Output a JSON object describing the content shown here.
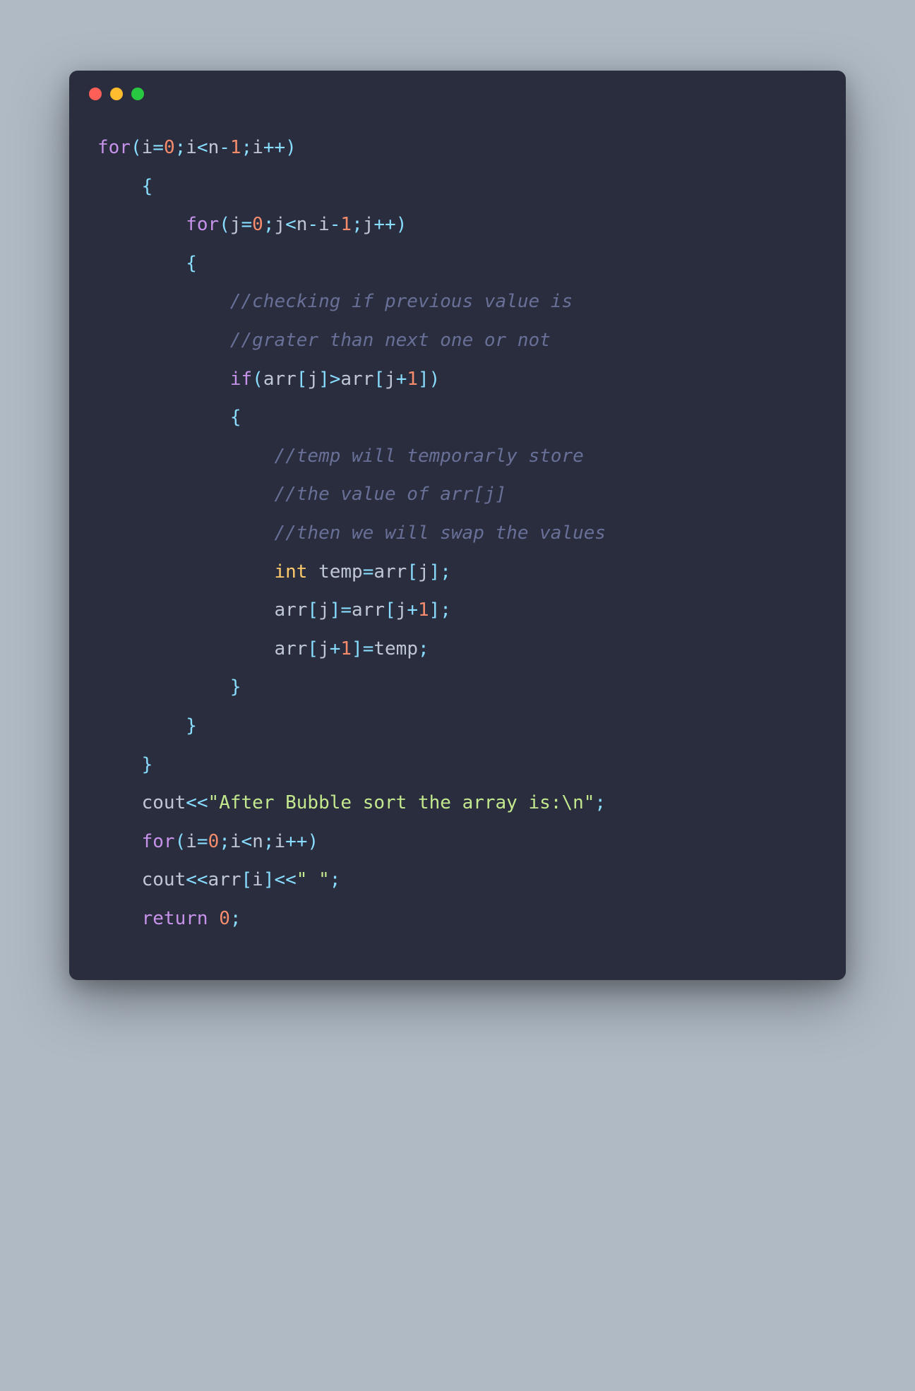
{
  "window": {
    "traffic_lights": [
      "close",
      "minimize",
      "zoom"
    ]
  },
  "colors": {
    "background_page": "#b0bac5",
    "background_window": "#292d3e",
    "keyword": "#c792ea",
    "operator": "#89ddff",
    "plain": "#bfc7d5",
    "number": "#f78c6c",
    "string": "#c3e88d",
    "comment": "#697098",
    "type": "#ffcb6b"
  },
  "code": {
    "lines": [
      [
        {
          "t": "kw",
          "v": "for"
        },
        {
          "t": "punct",
          "v": "("
        },
        {
          "t": "plain",
          "v": "i"
        },
        {
          "t": "op",
          "v": "="
        },
        {
          "t": "num",
          "v": "0"
        },
        {
          "t": "punct",
          "v": ";"
        },
        {
          "t": "plain",
          "v": "i"
        },
        {
          "t": "op",
          "v": "<"
        },
        {
          "t": "plain",
          "v": "n"
        },
        {
          "t": "op",
          "v": "-"
        },
        {
          "t": "num",
          "v": "1"
        },
        {
          "t": "punct",
          "v": ";"
        },
        {
          "t": "plain",
          "v": "i"
        },
        {
          "t": "op",
          "v": "++"
        },
        {
          "t": "punct",
          "v": ")"
        }
      ],
      [
        {
          "t": "plain",
          "v": "    "
        },
        {
          "t": "punct",
          "v": "{"
        }
      ],
      [
        {
          "t": "plain",
          "v": "        "
        },
        {
          "t": "kw",
          "v": "for"
        },
        {
          "t": "punct",
          "v": "("
        },
        {
          "t": "plain",
          "v": "j"
        },
        {
          "t": "op",
          "v": "="
        },
        {
          "t": "num",
          "v": "0"
        },
        {
          "t": "punct",
          "v": ";"
        },
        {
          "t": "plain",
          "v": "j"
        },
        {
          "t": "op",
          "v": "<"
        },
        {
          "t": "plain",
          "v": "n"
        },
        {
          "t": "op",
          "v": "-"
        },
        {
          "t": "plain",
          "v": "i"
        },
        {
          "t": "op",
          "v": "-"
        },
        {
          "t": "num",
          "v": "1"
        },
        {
          "t": "punct",
          "v": ";"
        },
        {
          "t": "plain",
          "v": "j"
        },
        {
          "t": "op",
          "v": "++"
        },
        {
          "t": "punct",
          "v": ")"
        }
      ],
      [
        {
          "t": "plain",
          "v": "        "
        },
        {
          "t": "punct",
          "v": "{"
        }
      ],
      [
        {
          "t": "plain",
          "v": "            "
        },
        {
          "t": "comment",
          "v": "//checking if previous value is"
        }
      ],
      [
        {
          "t": "plain",
          "v": "            "
        },
        {
          "t": "comment",
          "v": "//grater than next one or not"
        }
      ],
      [
        {
          "t": "plain",
          "v": "            "
        },
        {
          "t": "kw",
          "v": "if"
        },
        {
          "t": "punct",
          "v": "("
        },
        {
          "t": "plain",
          "v": "arr"
        },
        {
          "t": "punct",
          "v": "["
        },
        {
          "t": "plain",
          "v": "j"
        },
        {
          "t": "punct",
          "v": "]"
        },
        {
          "t": "op",
          "v": ">"
        },
        {
          "t": "plain",
          "v": "arr"
        },
        {
          "t": "punct",
          "v": "["
        },
        {
          "t": "plain",
          "v": "j"
        },
        {
          "t": "op",
          "v": "+"
        },
        {
          "t": "num",
          "v": "1"
        },
        {
          "t": "punct",
          "v": "]"
        },
        {
          "t": "punct",
          "v": ")"
        }
      ],
      [
        {
          "t": "plain",
          "v": "            "
        },
        {
          "t": "punct",
          "v": "{"
        }
      ],
      [
        {
          "t": "plain",
          "v": "                "
        },
        {
          "t": "comment",
          "v": "//temp will temporarly store"
        }
      ],
      [
        {
          "t": "plain",
          "v": "                "
        },
        {
          "t": "comment",
          "v": "//the value of arr[j]"
        }
      ],
      [
        {
          "t": "plain",
          "v": "                "
        },
        {
          "t": "comment",
          "v": "//then we will swap the values"
        }
      ],
      [
        {
          "t": "plain",
          "v": "                "
        },
        {
          "t": "type",
          "v": "int"
        },
        {
          "t": "plain",
          "v": " temp"
        },
        {
          "t": "op",
          "v": "="
        },
        {
          "t": "plain",
          "v": "arr"
        },
        {
          "t": "punct",
          "v": "["
        },
        {
          "t": "plain",
          "v": "j"
        },
        {
          "t": "punct",
          "v": "]"
        },
        {
          "t": "punct",
          "v": ";"
        }
      ],
      [
        {
          "t": "plain",
          "v": "                arr"
        },
        {
          "t": "punct",
          "v": "["
        },
        {
          "t": "plain",
          "v": "j"
        },
        {
          "t": "punct",
          "v": "]"
        },
        {
          "t": "op",
          "v": "="
        },
        {
          "t": "plain",
          "v": "arr"
        },
        {
          "t": "punct",
          "v": "["
        },
        {
          "t": "plain",
          "v": "j"
        },
        {
          "t": "op",
          "v": "+"
        },
        {
          "t": "num",
          "v": "1"
        },
        {
          "t": "punct",
          "v": "]"
        },
        {
          "t": "punct",
          "v": ";"
        }
      ],
      [
        {
          "t": "plain",
          "v": "                arr"
        },
        {
          "t": "punct",
          "v": "["
        },
        {
          "t": "plain",
          "v": "j"
        },
        {
          "t": "op",
          "v": "+"
        },
        {
          "t": "num",
          "v": "1"
        },
        {
          "t": "punct",
          "v": "]"
        },
        {
          "t": "op",
          "v": "="
        },
        {
          "t": "plain",
          "v": "temp"
        },
        {
          "t": "punct",
          "v": ";"
        }
      ],
      [
        {
          "t": "plain",
          "v": "            "
        },
        {
          "t": "punct",
          "v": "}"
        }
      ],
      [
        {
          "t": "plain",
          "v": "        "
        },
        {
          "t": "punct",
          "v": "}"
        }
      ],
      [
        {
          "t": "plain",
          "v": "    "
        },
        {
          "t": "punct",
          "v": "}"
        }
      ],
      [
        {
          "t": "plain",
          "v": "    cout"
        },
        {
          "t": "op",
          "v": "<<"
        },
        {
          "t": "str",
          "v": "\"After Bubble sort the array is:\\n\""
        },
        {
          "t": "punct",
          "v": ";"
        }
      ],
      [
        {
          "t": "plain",
          "v": "    "
        },
        {
          "t": "kw",
          "v": "for"
        },
        {
          "t": "punct",
          "v": "("
        },
        {
          "t": "plain",
          "v": "i"
        },
        {
          "t": "op",
          "v": "="
        },
        {
          "t": "num",
          "v": "0"
        },
        {
          "t": "punct",
          "v": ";"
        },
        {
          "t": "plain",
          "v": "i"
        },
        {
          "t": "op",
          "v": "<"
        },
        {
          "t": "plain",
          "v": "n"
        },
        {
          "t": "punct",
          "v": ";"
        },
        {
          "t": "plain",
          "v": "i"
        },
        {
          "t": "op",
          "v": "++"
        },
        {
          "t": "punct",
          "v": ")"
        }
      ],
      [
        {
          "t": "plain",
          "v": "    cout"
        },
        {
          "t": "op",
          "v": "<<"
        },
        {
          "t": "plain",
          "v": "arr"
        },
        {
          "t": "punct",
          "v": "["
        },
        {
          "t": "plain",
          "v": "i"
        },
        {
          "t": "punct",
          "v": "]"
        },
        {
          "t": "op",
          "v": "<<"
        },
        {
          "t": "str",
          "v": "\" \""
        },
        {
          "t": "punct",
          "v": ";"
        }
      ],
      [
        {
          "t": "plain",
          "v": "    "
        },
        {
          "t": "kw",
          "v": "return"
        },
        {
          "t": "plain",
          "v": " "
        },
        {
          "t": "num",
          "v": "0"
        },
        {
          "t": "punct",
          "v": ";"
        }
      ]
    ]
  }
}
